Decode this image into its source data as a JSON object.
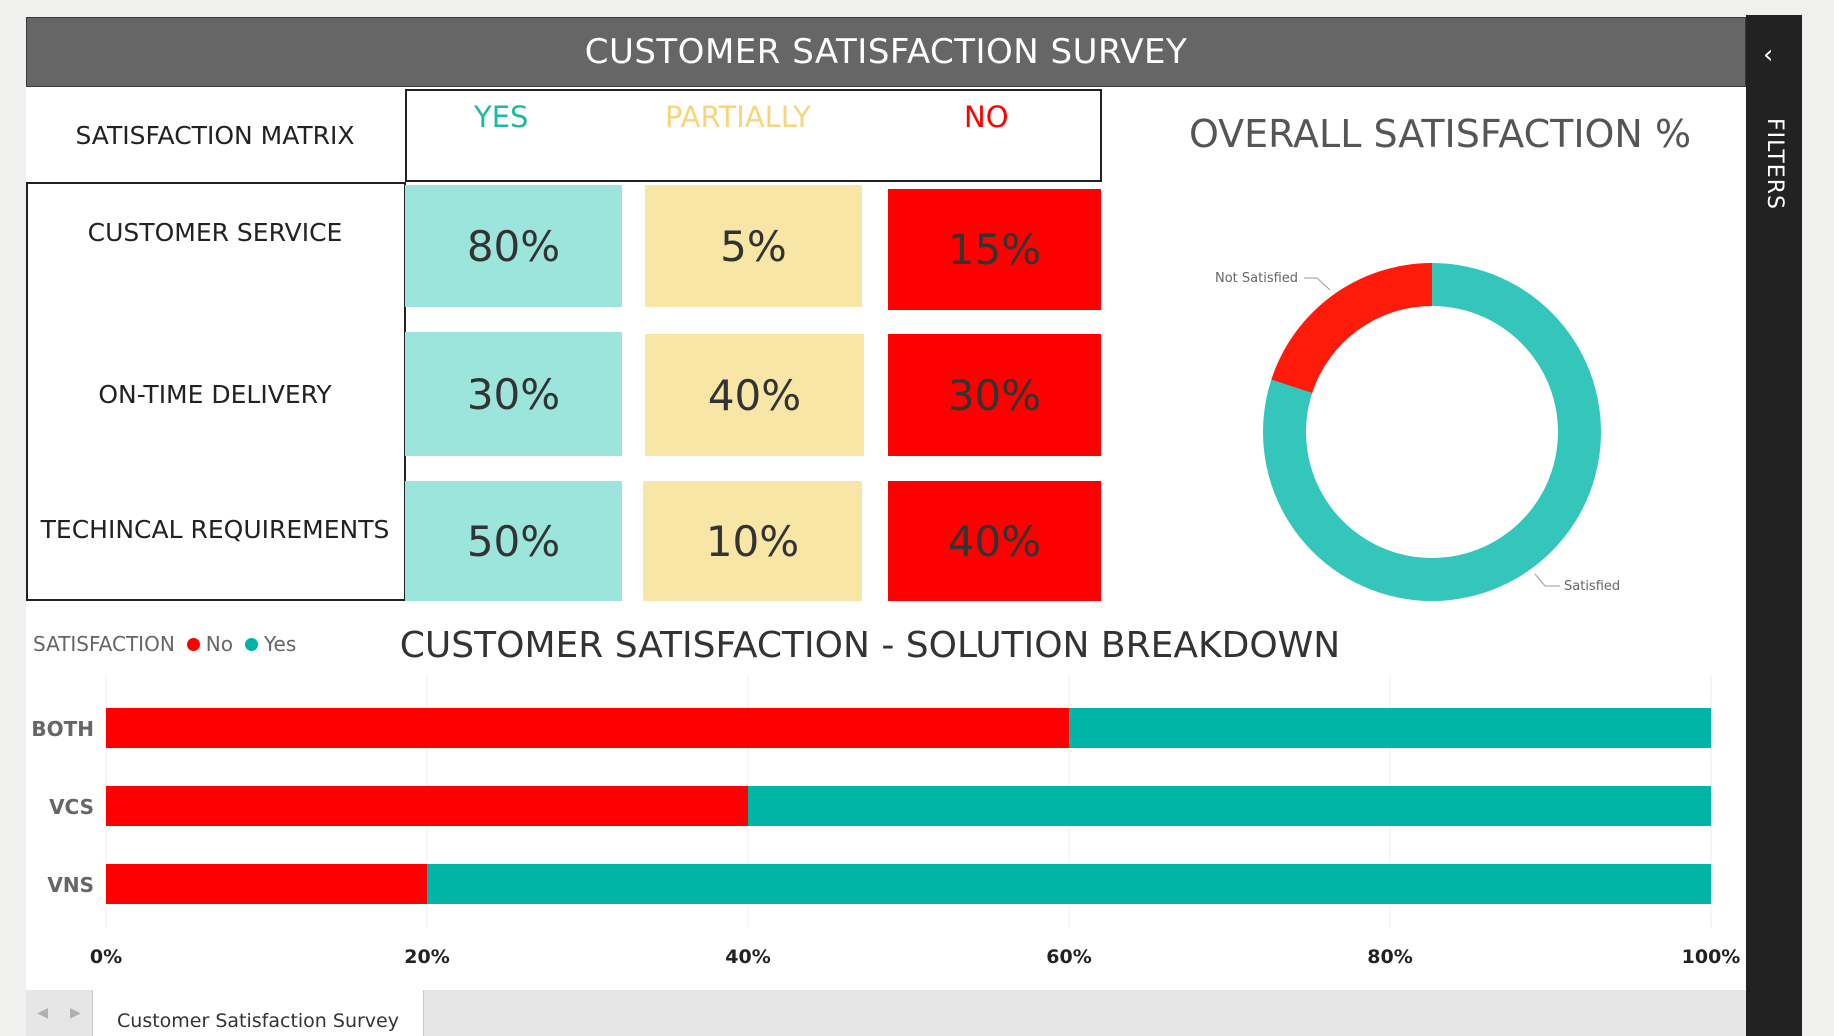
{
  "report": {
    "title": "CUSTOMER SATISFACTION SURVEY"
  },
  "matrix": {
    "title": "SATISFACTION MATRIX",
    "columns": [
      {
        "label": "YES",
        "color": "#1abc9c"
      },
      {
        "label": "PARTIALLY",
        "color": "#f5d77a"
      },
      {
        "label": "NO",
        "color": "#ff0000"
      }
    ],
    "rows": [
      {
        "label": "CUSTOMER SERVICE",
        "values": [
          "80%",
          "5%",
          "15%"
        ]
      },
      {
        "label": "ON-TIME DELIVERY",
        "values": [
          "30%",
          "40%",
          "30%"
        ]
      },
      {
        "label": "TECHINCAL REQUIREMENTS",
        "values": [
          "50%",
          "10%",
          "40%"
        ]
      }
    ],
    "cell_colors": [
      "#9ce5dc",
      "#f8e6a6",
      "#ff0000"
    ]
  },
  "overall": {
    "title": "OVERALL SATISFACTION %",
    "labels": {
      "not_satisfied": "Not Satisfied",
      "satisfied": "Satisfied"
    }
  },
  "breakdown": {
    "title": "CUSTOMER SATISFACTION - SOLUTION BREAKDOWN",
    "legend_title": "SATISFACTION",
    "legend": [
      {
        "label": "No",
        "color": "#ff0000"
      },
      {
        "label": "Yes",
        "color": "#00b5a5"
      }
    ],
    "x_ticks": [
      "0%",
      "20%",
      "40%",
      "60%",
      "80%",
      "100%"
    ]
  },
  "chart_data": [
    {
      "type": "pie",
      "title": "OVERALL SATISFACTION %",
      "categories": [
        "Satisfied",
        "Not Satisfied"
      ],
      "values": [
        80,
        20
      ],
      "colors": [
        "#34c6bb",
        "#ff1a0a"
      ]
    },
    {
      "type": "bar",
      "orientation": "horizontal",
      "stacked": "percent",
      "title": "CUSTOMER SATISFACTION - SOLUTION BREAKDOWN",
      "categories": [
        "BOTH",
        "VCS",
        "VNS"
      ],
      "series": [
        {
          "name": "No",
          "values": [
            60,
            40,
            20
          ],
          "color": "#ff0000"
        },
        {
          "name": "Yes",
          "values": [
            40,
            60,
            80
          ],
          "color": "#00b5a5"
        }
      ],
      "xlim": [
        0,
        100
      ],
      "x_ticks": [
        "0%",
        "20%",
        "40%",
        "60%",
        "80%",
        "100%"
      ],
      "grid": true,
      "legend": "top-left"
    }
  ],
  "pages": {
    "active": "Customer Satisfaction Survey"
  },
  "filters_pane": {
    "label": "FILTERS"
  }
}
